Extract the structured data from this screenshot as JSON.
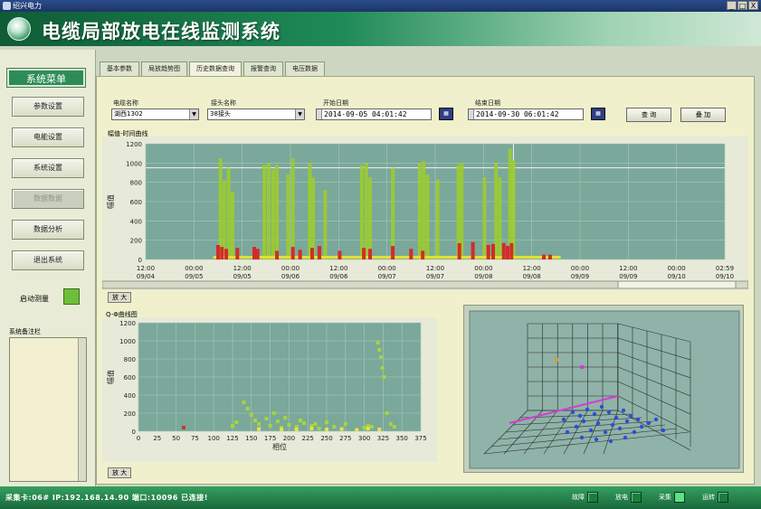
{
  "window": {
    "title": "绍兴电力",
    "min_label": "_",
    "max_label": "□",
    "close_label": "X"
  },
  "banner": {
    "title": "电缆局部放电在线监测系统"
  },
  "sidebar": {
    "menu_title": "系统菜单",
    "buttons": [
      "参数设置",
      "电能设置",
      "系统设置",
      "数据数据",
      "数据分析",
      "退出系统"
    ],
    "start_label": "启动测量",
    "remarks_label": "系统备注栏"
  },
  "tabs": [
    "基本参数",
    "局放趋势图",
    "历史数据查询",
    "报警查询",
    "电压数据"
  ],
  "query": {
    "cable_label": "电缆名称",
    "cable_value": "湖西1302",
    "joint_label": "接头名称",
    "joint_value": "38接头",
    "start_label": "开始日期",
    "start_value": "2014-09-05 04:01:42",
    "end_label": "结束日期",
    "end_value": "2014-09-30 06:01:42",
    "query_button": "查 询",
    "add_button": "叠 加"
  },
  "chart_top": {
    "title": "幅值-时间曲线",
    "tool": "放 大"
  },
  "chart_bottom": {
    "title": "Q-Φ曲线图",
    "tool": "放 大"
  },
  "statusbar": {
    "text": "采集卡:06# IP:192.168.14.90 端口:10096 已连接!",
    "indicators": [
      {
        "label": "故障",
        "on": false
      },
      {
        "label": "放电",
        "on": false
      },
      {
        "label": "采集",
        "on": true
      },
      {
        "label": "运转",
        "on": false
      }
    ]
  },
  "chart_data": [
    {
      "type": "bar",
      "ylabel": "幅值",
      "ylim": [
        0,
        1200
      ],
      "yticks": [
        0,
        200,
        400,
        600,
        800,
        1000,
        1200
      ],
      "x_ticks": [
        {
          "time": "12:00",
          "date": "09/04"
        },
        {
          "time": "00:00",
          "date": "09/05"
        },
        {
          "time": "12:00",
          "date": "09/05"
        },
        {
          "time": "00:00",
          "date": "09/06"
        },
        {
          "time": "12:00",
          "date": "09/06"
        },
        {
          "time": "00:00",
          "date": "09/07"
        },
        {
          "time": "12:00",
          "date": "09/07"
        },
        {
          "time": "00:00",
          "date": "09/08"
        },
        {
          "time": "12:00",
          "date": "09/08"
        },
        {
          "time": "00:00",
          "date": "09/09"
        },
        {
          "time": "12:00",
          "date": "09/09"
        },
        {
          "time": "00:00",
          "date": "09/10"
        },
        {
          "time": "02:59",
          "date": "09/10"
        }
      ],
      "series": [
        {
          "color": "#9ccc2e",
          "points": [
            [
              1.55,
              1050
            ],
            [
              1.63,
              820
            ],
            [
              1.72,
              950
            ],
            [
              1.8,
              700
            ],
            [
              2.46,
              980
            ],
            [
              2.55,
              1000
            ],
            [
              2.64,
              930
            ],
            [
              2.72,
              980
            ],
            [
              2.95,
              880
            ],
            [
              3.05,
              1050
            ],
            [
              3.4,
              1000
            ],
            [
              3.47,
              850
            ],
            [
              3.72,
              720
            ],
            [
              4.48,
              980
            ],
            [
              4.57,
              1000
            ],
            [
              4.65,
              850
            ],
            [
              5.12,
              950
            ],
            [
              5.68,
              1000
            ],
            [
              5.76,
              1020
            ],
            [
              5.84,
              880
            ],
            [
              6.05,
              830
            ],
            [
              6.48,
              980
            ],
            [
              6.55,
              1000
            ],
            [
              7.02,
              850
            ],
            [
              7.26,
              1000
            ],
            [
              7.34,
              850
            ],
            [
              7.55,
              1150
            ],
            [
              7.62,
              1030
            ]
          ]
        },
        {
          "color": "#d42b2b",
          "points": [
            [
              1.5,
              150
            ],
            [
              1.58,
              130
            ],
            [
              1.67,
              110
            ],
            [
              1.9,
              120
            ],
            [
              2.25,
              130
            ],
            [
              2.32,
              110
            ],
            [
              2.72,
              90
            ],
            [
              3.05,
              130
            ],
            [
              3.2,
              100
            ],
            [
              3.45,
              120
            ],
            [
              3.6,
              140
            ],
            [
              4.02,
              90
            ],
            [
              4.52,
              120
            ],
            [
              4.65,
              110
            ],
            [
              5.12,
              140
            ],
            [
              5.5,
              110
            ],
            [
              5.74,
              90
            ],
            [
              6.5,
              170
            ],
            [
              6.78,
              180
            ],
            [
              7.1,
              150
            ],
            [
              7.2,
              160
            ],
            [
              7.42,
              170
            ],
            [
              7.5,
              140
            ],
            [
              7.58,
              170
            ],
            [
              8.25,
              50
            ],
            [
              8.38,
              50
            ]
          ]
        }
      ]
    },
    {
      "type": "scatter",
      "xlabel": "相位",
      "ylabel": "幅值",
      "xlim": [
        0,
        375
      ],
      "ylim": [
        0,
        1200
      ],
      "xticks": [
        0,
        25,
        50,
        75,
        100,
        125,
        150,
        175,
        200,
        225,
        250,
        275,
        300,
        325,
        350,
        375
      ],
      "yticks": [
        0,
        200,
        400,
        600,
        800,
        1000,
        1200
      ],
      "series": [
        {
          "color": "#a8d43a",
          "points": [
            [
              140,
              320
            ],
            [
              145,
              250
            ],
            [
              150,
              180
            ],
            [
              155,
              120
            ],
            [
              160,
              80
            ],
            [
              170,
              140
            ],
            [
              175,
              60
            ],
            [
              185,
              110
            ],
            [
              190,
              40
            ],
            [
              200,
              70
            ],
            [
              210,
              50
            ],
            [
              220,
              90
            ],
            [
              230,
              60
            ],
            [
              240,
              30
            ],
            [
              250,
              100
            ],
            [
              260,
              50
            ],
            [
              275,
              80
            ],
            [
              300,
              40
            ],
            [
              305,
              60
            ],
            [
              310,
              50
            ],
            [
              318,
              980
            ],
            [
              320,
              900
            ],
            [
              322,
              820
            ],
            [
              324,
              700
            ],
            [
              326,
              600
            ],
            [
              330,
              200
            ],
            [
              335,
              80
            ],
            [
              340,
              50
            ],
            [
              180,
              200
            ],
            [
              195,
              150
            ],
            [
              215,
              120
            ],
            [
              235,
              80
            ],
            [
              130,
              100
            ],
            [
              125,
              60
            ]
          ]
        },
        {
          "color": "#e8e050",
          "points": [
            [
              210,
              20
            ],
            [
              230,
              30
            ],
            [
              250,
              20
            ],
            [
              270,
              25
            ],
            [
              290,
              15
            ],
            [
              305,
              30
            ],
            [
              320,
              20
            ],
            [
              160,
              25
            ],
            [
              190,
              20
            ]
          ]
        },
        {
          "color": "#c23b2b",
          "points": [
            [
              60,
              40
            ]
          ]
        }
      ]
    },
    {
      "type": "scatter",
      "title": "",
      "series": [
        {
          "color": "#2b4fd6",
          "points": [
            [
              0.3,
              0.4,
              0.3
            ],
            [
              0.4,
              0.45,
              0.35
            ],
            [
              0.5,
              0.5,
              0.4
            ],
            [
              0.6,
              0.55,
              0.3
            ]
          ]
        },
        {
          "color": "#d43ad4",
          "points": [
            [
              0.5,
              0.3,
              0.5
            ]
          ]
        },
        {
          "color": "#e0a020",
          "points": [
            [
              0.2,
              0.6,
              0.4
            ]
          ]
        }
      ]
    }
  ]
}
